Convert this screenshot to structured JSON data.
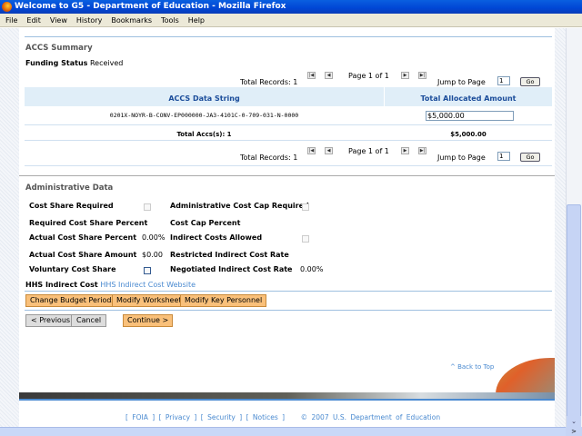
{
  "window": {
    "title": "Welcome to G5 - Department of Education - Mozilla Firefox"
  },
  "menu": [
    "File",
    "Edit",
    "View",
    "History",
    "Bookmarks",
    "Tools",
    "Help"
  ],
  "accs": {
    "heading": "ACCS Summary",
    "funding_label": "Funding Status",
    "funding_value": "Received",
    "pager": {
      "total_records": "Total Records: 1",
      "page": "Page 1 of 1",
      "jump_label": "Jump to Page",
      "jump_value": "1",
      "go": "Go"
    },
    "columns": [
      "ACCS Data String",
      "Total Allocated Amount"
    ],
    "rows": [
      {
        "data_string": "0201X-NOYR-B-CONV-EP000000-JA3-4101C-0-709-031-N-0000",
        "amount": "$5,000.00"
      }
    ],
    "total_label": "Total Accs(s): 1",
    "total_amount": "$5,000.00"
  },
  "admin": {
    "heading": "Administrative Data",
    "cost_share_required": "Cost Share Required",
    "admin_cost_cap_required": "Administrative Cost Cap Required",
    "required_cost_share_percent": "Required Cost Share Percent",
    "cost_cap_percent": "Cost Cap Percent",
    "actual_cost_share_percent": "Actual Cost Share Percent",
    "actual_cost_share_percent_value": "0.00%",
    "indirect_costs_allowed": "Indirect Costs Allowed",
    "actual_cost_share_amount": "Actual Cost Share Amount",
    "actual_cost_share_amount_value": "$0.00",
    "restricted_indirect_cost_rate": "Restricted Indirect Cost Rate",
    "voluntary_cost_share": "Voluntary Cost Share",
    "negotiated_indirect_cost_rate": "Negotiated Indirect Cost Rate",
    "negotiated_value": "0.00%",
    "hhs_label": "HHS Indirect Cost",
    "hhs_link": "HHS Indirect Cost Website"
  },
  "buttons": {
    "change_budget": "Change Budget Periods",
    "modify_worksheet": "Modify Worksheet",
    "modify_personnel": "Modify Key Personnel",
    "previous": "< Previous",
    "cancel": "Cancel",
    "continue": "Continue >"
  },
  "back_to_top": "^ Back to Top",
  "footer": {
    "foia": "FOIA",
    "privacy": "Privacy",
    "security": "Security",
    "notices": "Notices",
    "copyright": "© 2007 U.S. Department of Education"
  },
  "colors": {
    "header_bg": "#e0eef8",
    "header_text": "#1a4c9a",
    "button_orange": "#f9c07a",
    "link": "#4a8ad0"
  }
}
